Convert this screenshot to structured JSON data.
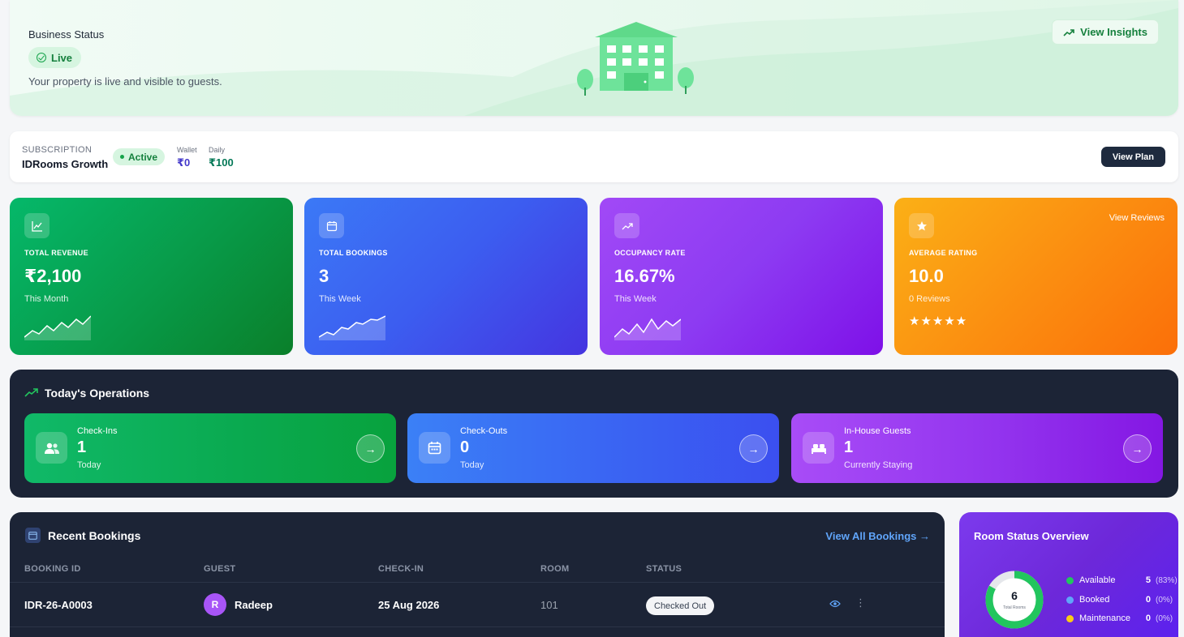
{
  "banner": {
    "title": "Business Status",
    "status": "Live",
    "description": "Your property is live and visible to guests.",
    "insights_label": "View Insights"
  },
  "subscription": {
    "label": "SUBSCRIPTION",
    "plan": "IDRooms Growth",
    "badge": "Active",
    "wallet_label": "Wallet",
    "wallet_value": "₹0",
    "daily_label": "Daily",
    "daily_value": "₹100",
    "button": "View Plan"
  },
  "stats": {
    "revenue": {
      "label": "TOTAL REVENUE",
      "value": "₹2,100",
      "sub": "This Month"
    },
    "bookings": {
      "label": "TOTAL BOOKINGS",
      "value": "3",
      "sub": "This Week"
    },
    "occupancy": {
      "label": "OCCUPANCY RATE",
      "value": "16.67%",
      "sub": "This Week"
    },
    "rating": {
      "label": "AVERAGE RATING",
      "value": "10.0",
      "sub": "0 Reviews",
      "link": "View Reviews",
      "stars": "★★★★★",
      "star_count": 5
    }
  },
  "operations": {
    "title": "Today's Operations",
    "checkins": {
      "label": "Check-Ins",
      "value": "1",
      "sub": "Today"
    },
    "checkouts": {
      "label": "Check-Outs",
      "value": "0",
      "sub": "Today"
    },
    "inhouse": {
      "label": "In-House Guests",
      "value": "1",
      "sub": "Currently Staying"
    },
    "arrow": "→"
  },
  "bookings": {
    "title": "Recent Bookings",
    "view_all": "View All Bookings →",
    "columns": [
      "BOOKING ID",
      "GUEST",
      "CHECK-IN",
      "ROOM",
      "STATUS"
    ],
    "rows": [
      {
        "id": "IDR-26-A0003",
        "initial": "R",
        "guest": "Radeep",
        "checkin": "25 Aug 2026",
        "room": "101",
        "status": "Checked Out"
      }
    ],
    "more_icon": "⋮"
  },
  "room_status": {
    "title": "Room Status Overview",
    "total": "6",
    "total_label": "Total Rooms",
    "legend": [
      {
        "name": "Available",
        "value": "5",
        "pct": "(83%)",
        "color": "#22c55e"
      },
      {
        "name": "Booked",
        "value": "0",
        "pct": "(0%)",
        "color": "#60a5fa"
      },
      {
        "name": "Maintenance",
        "value": "0",
        "pct": "(0%)",
        "color": "#facc15"
      }
    ]
  },
  "colors": {
    "green": "#16a34a",
    "blue": "#3b82f6",
    "purple": "#8b5cf6",
    "orange": "#f97316",
    "dark": "#1c2436"
  }
}
